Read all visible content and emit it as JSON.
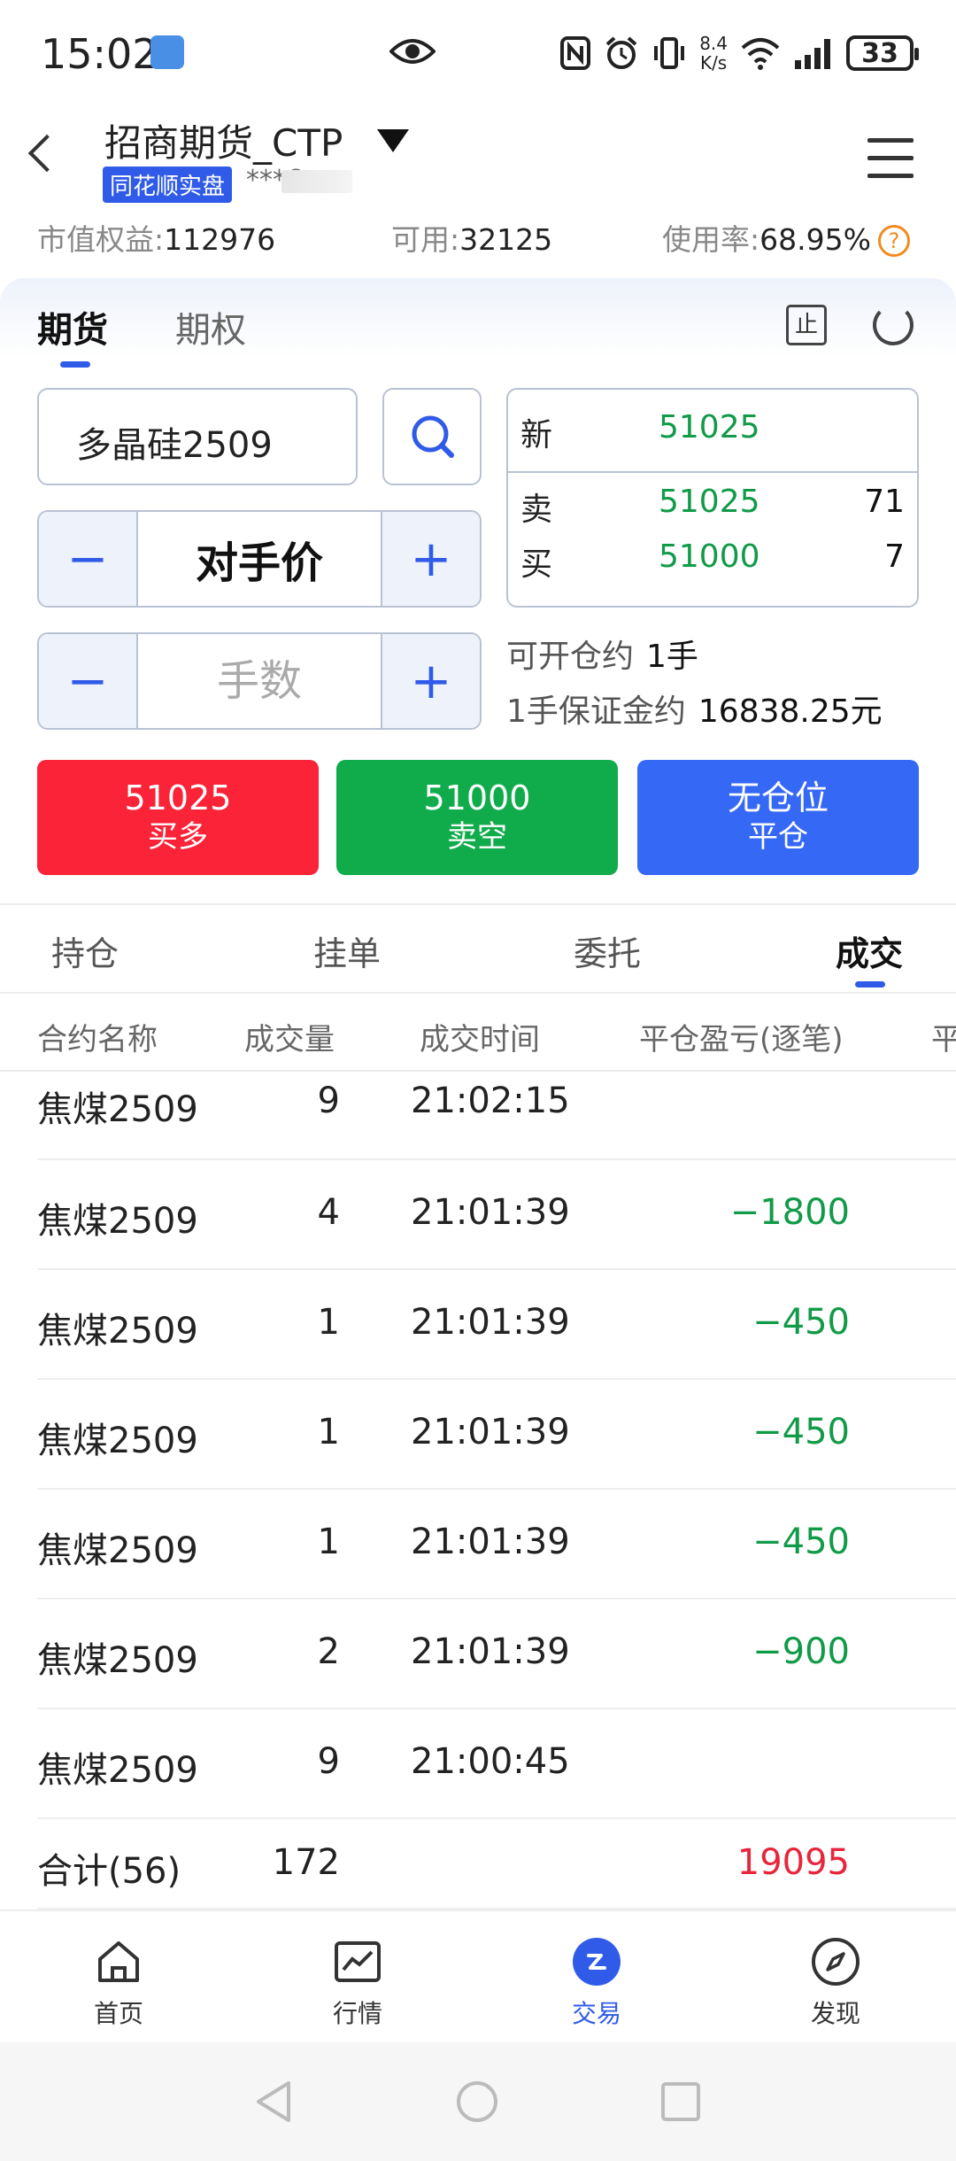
{
  "status": {
    "time": "15:02",
    "net_speed_value": "8.4",
    "net_speed_unit": "K/s",
    "battery": "33"
  },
  "header": {
    "account_name": "招商期货_CTP",
    "badge": "同花顺实盘",
    "account_no": "***6"
  },
  "equity": {
    "market_label": "市值权益:",
    "market_value": "112976",
    "avail_label": "可用:",
    "avail_value": "32125",
    "usage_label": "使用率:",
    "usage_value": "68.95%",
    "help": "?"
  },
  "tabs": [
    {
      "label": "期货"
    },
    {
      "label": "期权"
    }
  ],
  "stop_icon_text": "止",
  "order": {
    "contract": "多晶硅2509",
    "price_mode": "对手价",
    "qty_placeholder": "手数",
    "minus": "−",
    "plus": "+"
  },
  "quote": {
    "last_label": "新",
    "last_price": "51025",
    "ask_label": "卖",
    "ask_price": "51025",
    "ask_vol": "71",
    "bid_label": "买",
    "bid_price": "51000",
    "bid_vol": "7"
  },
  "info": {
    "open_label": "可开仓约",
    "open_value": "1手",
    "margin_label": "1手保证金约",
    "margin_value": "16838.25元"
  },
  "actions": {
    "buy_price": "51025",
    "buy_label": "买多",
    "sell_price": "51000",
    "sell_label": "卖空",
    "close_top": "无仓位",
    "close_label": "平仓"
  },
  "bottom_tabs": [
    {
      "label": "持仓"
    },
    {
      "label": "挂单"
    },
    {
      "label": "委托"
    },
    {
      "label": "成交"
    }
  ],
  "table": {
    "headers": [
      "合约名称",
      "成交量",
      "成交时间",
      "平仓盈亏(逐笔)",
      "平"
    ],
    "rows": [
      {
        "name": "焦煤2509",
        "qty": "9",
        "time": "21:02:15",
        "pnl": ""
      },
      {
        "name": "焦煤2509",
        "qty": "4",
        "time": "21:01:39",
        "pnl": "−1800"
      },
      {
        "name": "焦煤2509",
        "qty": "1",
        "time": "21:01:39",
        "pnl": "−450"
      },
      {
        "name": "焦煤2509",
        "qty": "1",
        "time": "21:01:39",
        "pnl": "−450"
      },
      {
        "name": "焦煤2509",
        "qty": "1",
        "time": "21:01:39",
        "pnl": "−450"
      },
      {
        "name": "焦煤2509",
        "qty": "2",
        "time": "21:01:39",
        "pnl": "−900"
      },
      {
        "name": "焦煤2509",
        "qty": "9",
        "time": "21:00:45",
        "pnl": ""
      }
    ],
    "total": {
      "label": "合计(56)",
      "qty": "172",
      "pnl": "19095"
    }
  },
  "nav": [
    {
      "label": "首页"
    },
    {
      "label": "行情"
    },
    {
      "label": "交易"
    },
    {
      "label": "发现"
    }
  ],
  "colors": {
    "accent": "#2f5be8",
    "up": "#fa2337",
    "down": "#10ac4c",
    "close": "#3668f6"
  }
}
